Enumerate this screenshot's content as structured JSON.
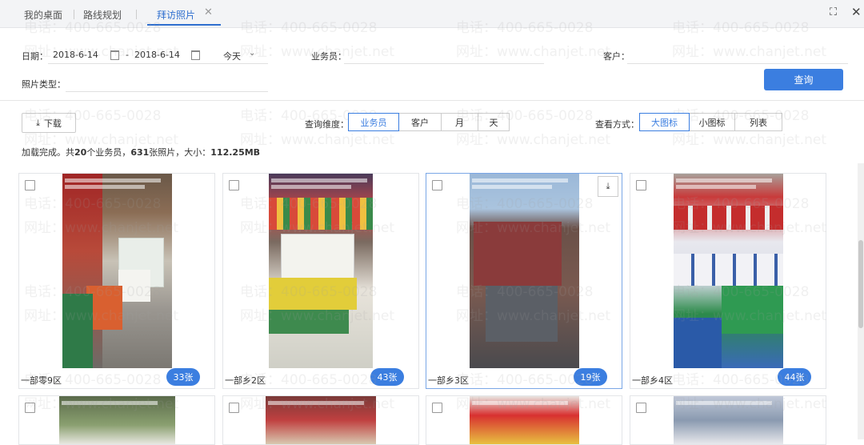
{
  "tabs": [
    {
      "label": "我的桌面",
      "active": false
    },
    {
      "label": "路线规划",
      "active": false
    },
    {
      "label": "拜访照片",
      "active": true
    }
  ],
  "filters": {
    "date_label": "日期：",
    "date_from": "2018-6-14",
    "date_sep": "-",
    "date_to": "2018-6-14",
    "period": "今天",
    "salesman_label": "业务员：",
    "customer_label": "客户：",
    "photo_type_label": "照片类型：",
    "query_label": "查询"
  },
  "toolbar": {
    "download_label": "下载",
    "dimension_label": "查询维度：",
    "dimensions": [
      "业务员",
      "客户",
      "月",
      "天"
    ],
    "view_label": "查看方式：",
    "views": [
      "大图标",
      "小图标",
      "列表"
    ]
  },
  "summary": {
    "prefix": "加载完成。共",
    "salesmen": "20",
    "mid1": "个业务员，",
    "photos": "631",
    "mid2": "张照片，大小：",
    "size": "112.25MB"
  },
  "cards": [
    {
      "name": "一部零9区",
      "count": "33张"
    },
    {
      "name": "一部乡2区",
      "count": "43张"
    },
    {
      "name": "一部乡3区",
      "count": "19张"
    },
    {
      "name": "一部乡4区",
      "count": "44张"
    }
  ],
  "watermark": {
    "phone": "电话：400-665-0028",
    "site": "网址：www.chanjet.net"
  },
  "colors": {
    "accent": "#3b7ee0"
  }
}
